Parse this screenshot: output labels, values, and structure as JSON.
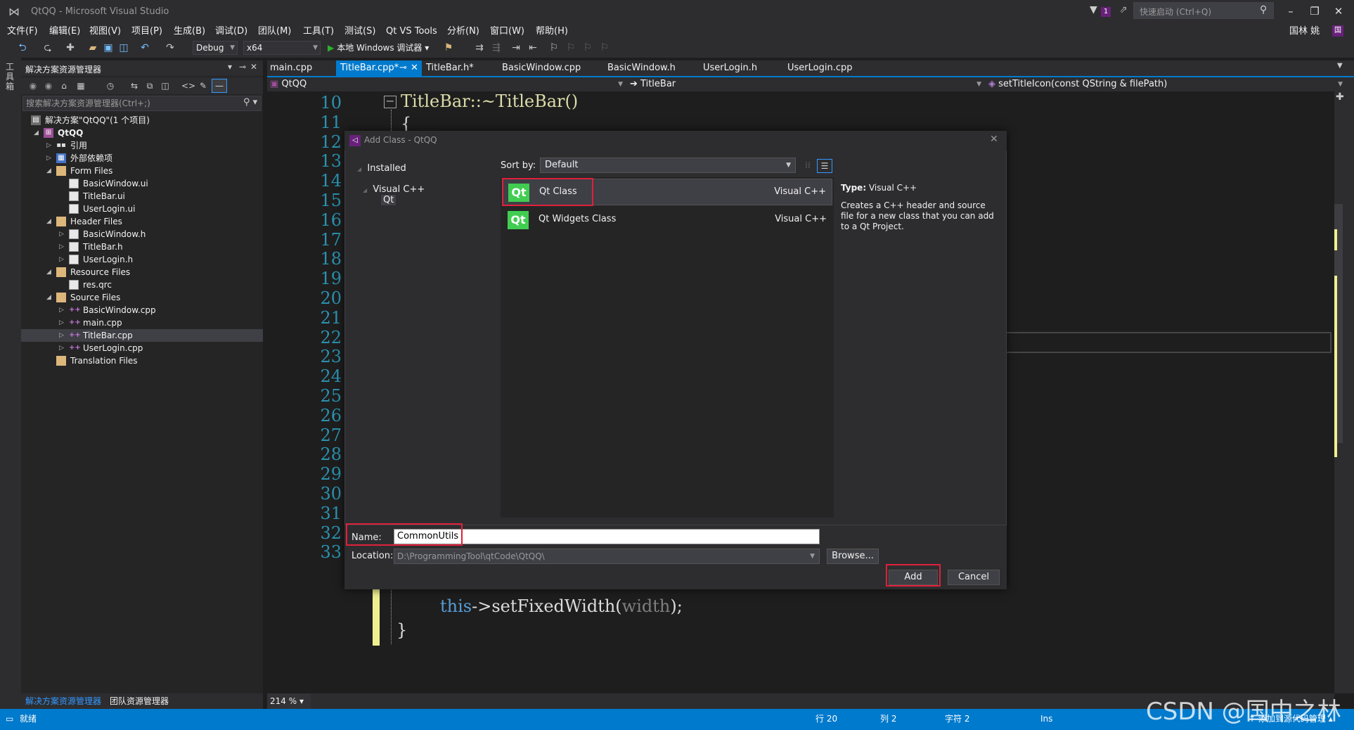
{
  "window": {
    "title": "QtQQ - Microsoft Visual Studio",
    "quick_launch_placeholder": "快速启动 (Ctrl+Q)",
    "notification_count": "1",
    "user_name": "国林 姚",
    "user_initial": "国"
  },
  "menu": [
    "文件(F)",
    "编辑(E)",
    "视图(V)",
    "项目(P)",
    "生成(B)",
    "调试(D)",
    "团队(M)",
    "工具(T)",
    "测试(S)",
    "Qt VS Tools",
    "分析(N)",
    "窗口(W)",
    "帮助(H)"
  ],
  "toolbar": {
    "config": "Debug",
    "platform": "x64",
    "run_label": "本地 Windows 调试器"
  },
  "toolstrip_label": "工具箱",
  "solution_explorer": {
    "title": "解决方案资源管理器",
    "search_placeholder": "搜索解决方案资源管理器(Ctrl+;)",
    "tree": [
      {
        "label": "解决方案\"QtQQ\"(1 个项目)",
        "level": 0,
        "icon": "solution",
        "arrow": ""
      },
      {
        "label": "QtQQ",
        "level": 1,
        "icon": "project",
        "arrow": "◢"
      },
      {
        "label": "引用",
        "level": 2,
        "icon": "references",
        "arrow": "▷"
      },
      {
        "label": "外部依赖项",
        "level": 2,
        "icon": "external",
        "arrow": "▷"
      },
      {
        "label": "Form Files",
        "level": 2,
        "icon": "folder",
        "arrow": "◢"
      },
      {
        "label": "BasicWindow.ui",
        "level": 3,
        "icon": "file",
        "arrow": ""
      },
      {
        "label": "TitleBar.ui",
        "level": 3,
        "icon": "file",
        "arrow": ""
      },
      {
        "label": "UserLogin.ui",
        "level": 3,
        "icon": "file",
        "arrow": ""
      },
      {
        "label": "Header Files",
        "level": 2,
        "icon": "folder",
        "arrow": "◢"
      },
      {
        "label": "BasicWindow.h",
        "level": 3,
        "icon": "file",
        "arrow": "▷"
      },
      {
        "label": "TitleBar.h",
        "level": 3,
        "icon": "file",
        "arrow": "▷"
      },
      {
        "label": "UserLogin.h",
        "level": 3,
        "icon": "file",
        "arrow": "▷"
      },
      {
        "label": "Resource Files",
        "level": 2,
        "icon": "folder",
        "arrow": "◢"
      },
      {
        "label": "res.qrc",
        "level": 3,
        "icon": "file",
        "arrow": ""
      },
      {
        "label": "Source Files",
        "level": 2,
        "icon": "folder",
        "arrow": "◢"
      },
      {
        "label": "BasicWindow.cpp",
        "level": 3,
        "icon": "cpp",
        "arrow": "▷"
      },
      {
        "label": "main.cpp",
        "level": 3,
        "icon": "cpp",
        "arrow": "▷"
      },
      {
        "label": "TitleBar.cpp",
        "level": 3,
        "icon": "cpp",
        "arrow": "▷",
        "selected": true
      },
      {
        "label": "UserLogin.cpp",
        "level": 3,
        "icon": "cpp",
        "arrow": "▷"
      },
      {
        "label": "Translation Files",
        "level": 2,
        "icon": "folder",
        "arrow": ""
      }
    ],
    "bottom_tabs": [
      "解决方案资源管理器",
      "团队资源管理器"
    ]
  },
  "editor": {
    "tabs": [
      {
        "label": "main.cpp",
        "active": false
      },
      {
        "label": "TitleBar.cpp*",
        "active": true
      },
      {
        "label": "TitleBar.h*",
        "active": false
      },
      {
        "label": "BasicWindow.cpp",
        "active": false
      },
      {
        "label": "BasicWindow.h",
        "active": false
      },
      {
        "label": "UserLogin.h",
        "active": false
      },
      {
        "label": "UserLogin.cpp",
        "active": false
      }
    ],
    "pin_glyph": "⊸",
    "close_glyph": "✕",
    "nav_project": "QtQQ",
    "nav_class": "TitleBar",
    "nav_member": "setTitleIcon(const QString & filePath)",
    "line_numbers": [
      "10",
      "11",
      "12",
      "13",
      "14",
      "15",
      "16",
      "17",
      "18",
      "19",
      "20",
      "21",
      "22",
      "23",
      "24",
      "25",
      "26",
      "27",
      "28",
      "29",
      "30",
      "31",
      "32",
      "33"
    ],
    "code_line_10_a": "TitleBar::",
    "code_line_10_b": "~TitleBar()",
    "code_line_11": "{",
    "code_line_31_kw": "this",
    "code_line_31_rest": "->setFixedWidth(",
    "code_line_31_arg": "width",
    "code_line_31_end": ");",
    "code_line_32": "}",
    "zoom": "214 %"
  },
  "dialog": {
    "title": "Add Class - QtQQ",
    "installed_label": "Installed",
    "tree_visualcpp": "Visual C++",
    "tree_qt": "Qt",
    "sort_label": "Sort by:",
    "sort_value": "Default",
    "templates": [
      {
        "name": "Qt Class",
        "lang": "Visual C++",
        "selected": true,
        "icon_text": "Qt"
      },
      {
        "name": "Qt Widgets Class",
        "lang": "Visual C++",
        "selected": false,
        "icon_text": "Qt"
      }
    ],
    "type_label": "Type:",
    "type_value": "Visual C++",
    "description": "Creates a C++ header and source file for a new class that you can add to a Qt Project.",
    "name_label": "Name:",
    "name_value": "CommonUtils",
    "location_label": "Location:",
    "location_value": "D:\\ProgrammingTool\\qtCode\\QtQQ\\",
    "browse_label": "Browse...",
    "add_label": "Add",
    "cancel_label": "Cancel"
  },
  "statusbar": {
    "ready": "就绪",
    "line": "行 20",
    "col": "列 2",
    "char": "字符 2",
    "mode": "Ins",
    "source_control": "添加到源代码管理"
  },
  "watermark": "CSDN @国中之林",
  "colors": {
    "accent": "#007acc",
    "highlight_red": "#e0203a",
    "qt_green": "#41cd52",
    "vs_purple": "#68217a"
  }
}
